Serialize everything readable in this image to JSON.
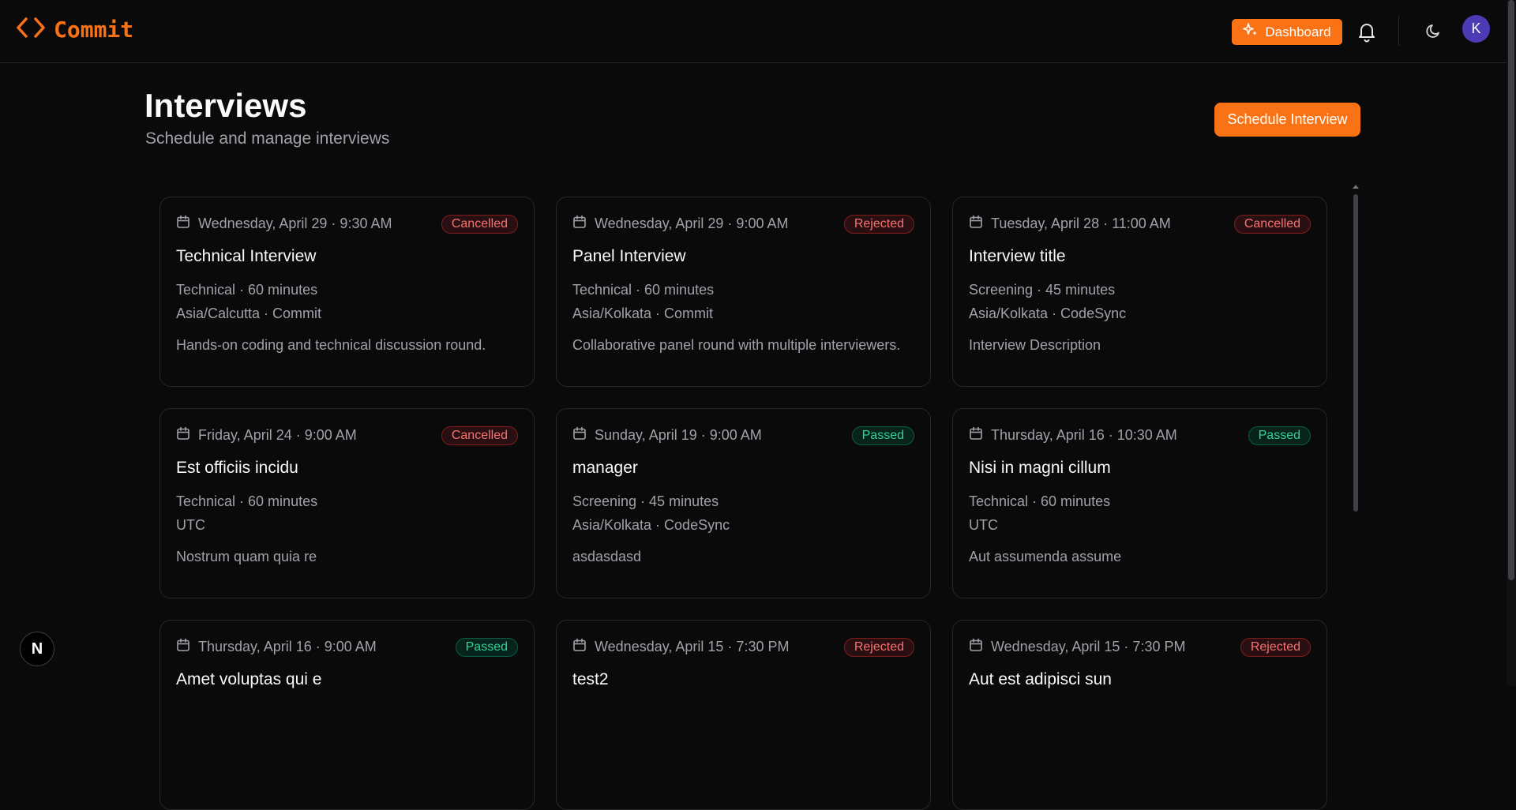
{
  "app": {
    "name": "Commit",
    "dashboard_label": "Dashboard",
    "avatar_initial": "K",
    "accent": "#f97316"
  },
  "page": {
    "title": "Interviews",
    "subtitle": "Schedule and manage interviews",
    "schedule_button": "Schedule Interview"
  },
  "interviews": [
    {
      "date": "Wednesday, April 29 · 9:30 AM",
      "status": "Cancelled",
      "status_color": "red",
      "title": "Technical Interview",
      "meta1": "Technical · 60 minutes",
      "meta2": "Asia/Calcutta · Commit",
      "description": "Hands-on coding and technical discussion round."
    },
    {
      "date": "Wednesday, April 29 · 9:00 AM",
      "status": "Rejected",
      "status_color": "red",
      "title": "Panel Interview",
      "meta1": "Technical · 60 minutes",
      "meta2": "Asia/Kolkata · Commit",
      "description": "Collaborative panel round with multiple interviewers."
    },
    {
      "date": "Tuesday, April 28 · 11:00 AM",
      "status": "Cancelled",
      "status_color": "red",
      "title": "Interview title",
      "meta1": "Screening · 45 minutes",
      "meta2": "Asia/Kolkata · CodeSync",
      "description": "Interview Description"
    },
    {
      "date": "Friday, April 24 · 9:00 AM",
      "status": "Cancelled",
      "status_color": "red",
      "title": "Est officiis incidu",
      "meta1": "Technical · 60 minutes",
      "meta2": "UTC",
      "description": "Nostrum quam quia re"
    },
    {
      "date": "Sunday, April 19 · 9:00 AM",
      "status": "Passed",
      "status_color": "green",
      "title": "manager",
      "meta1": "Screening · 45 minutes",
      "meta2": "Asia/Kolkata · CodeSync",
      "description": "asdasdasd"
    },
    {
      "date": "Thursday, April 16 · 10:30 AM",
      "status": "Passed",
      "status_color": "green",
      "title": "Nisi in magni cillum",
      "meta1": "Technical · 60 minutes",
      "meta2": "UTC",
      "description": "Aut assumenda assume"
    },
    {
      "date": "Thursday, April 16 · 9:00 AM",
      "status": "Passed",
      "status_color": "green",
      "title": "Amet voluptas qui e",
      "meta1": "",
      "meta2": "",
      "description": ""
    },
    {
      "date": "Wednesday, April 15 · 7:30 PM",
      "status": "Rejected",
      "status_color": "red",
      "title": "test2",
      "meta1": "",
      "meta2": "",
      "description": ""
    },
    {
      "date": "Wednesday, April 15 · 7:30 PM",
      "status": "Rejected",
      "status_color": "red",
      "title": "Aut est adipisci sun",
      "meta1": "",
      "meta2": "",
      "description": ""
    }
  ],
  "dev_badge": "N"
}
